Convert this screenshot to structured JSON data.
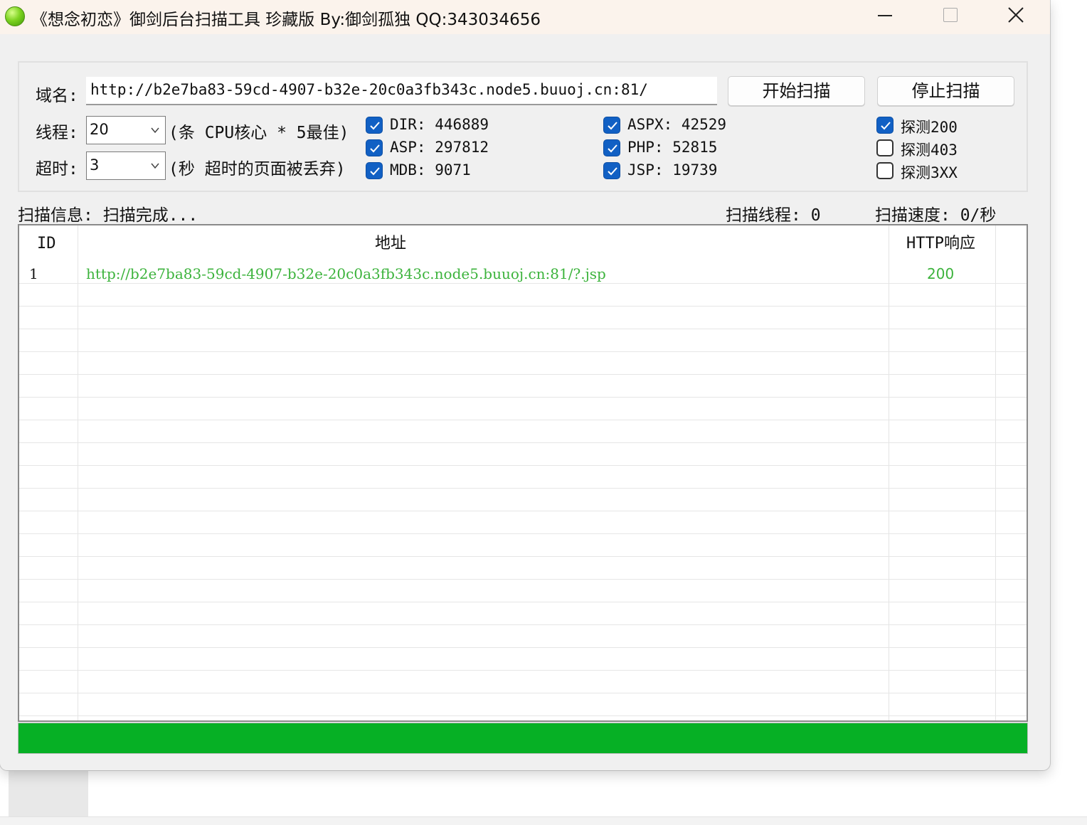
{
  "window": {
    "title": "《想念初恋》御剑后台扫描工具 珍藏版 By:御剑孤独 QQ:343034656"
  },
  "form": {
    "domain_label": "域名:",
    "domain_value": "http://b2e7ba83-59cd-4907-b32e-20c0a3fb343c.node5.buuoj.cn:81/",
    "threads_label": "线程:",
    "threads_value": "20",
    "threads_hint": "(条 CPU核心 * 5最佳)",
    "timeout_label": "超时:",
    "timeout_value": "3",
    "timeout_hint": "(秒 超时的页面被丢弃)",
    "start_button": "开始扫描",
    "stop_button": "停止扫描"
  },
  "dictionaries": [
    {
      "label": "DIR: 446889",
      "checked": true
    },
    {
      "label": "ASP: 297812",
      "checked": true
    },
    {
      "label": "MDB: 9071",
      "checked": true
    },
    {
      "label": "ASPX: 42529",
      "checked": true
    },
    {
      "label": "PHP: 52815",
      "checked": true
    },
    {
      "label": "JSP: 19739",
      "checked": true
    }
  ],
  "detect": [
    {
      "label": "探测200",
      "checked": true
    },
    {
      "label": "探测403",
      "checked": false
    },
    {
      "label": "探测3XX",
      "checked": false
    }
  ],
  "status": {
    "info": "扫描信息: 扫描完成...",
    "threads": "扫描线程: 0",
    "speed": "扫描速度: 0/秒"
  },
  "table": {
    "columns": [
      "ID",
      "地址",
      "HTTP响应"
    ],
    "rows": [
      {
        "id": "1",
        "url": "http://b2e7ba83-59cd-4907-b32e-20c0a3fb343c.node5.buuoj.cn:81/?.jsp",
        "code": "200"
      }
    ]
  },
  "progress": {
    "percent": 100
  },
  "colors": {
    "result_text": "#3cb33c",
    "progress_fill": "#06b025",
    "checkbox_on": "#1160c4"
  }
}
